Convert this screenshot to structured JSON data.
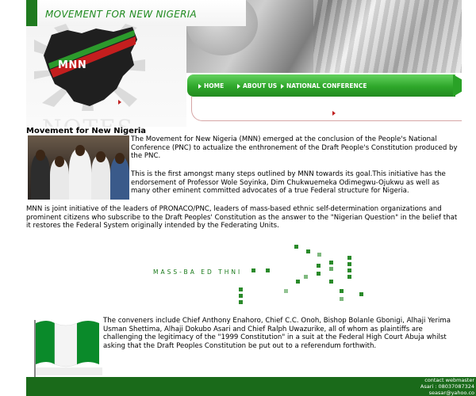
{
  "header": {
    "site_title": "MOVEMENT FOR NEW NIGERIA",
    "logo_text": "MNN",
    "watermark": "NOTES"
  },
  "nav": {
    "items": [
      {
        "label": "HOME"
      },
      {
        "label": "ABOUT US"
      },
      {
        "label": "NATIONAL CONFERENCE"
      }
    ]
  },
  "main": {
    "heading": "Movement for New Nigeria",
    "paragraphs": [
      "The Movement for New Nigeria (MNN) emerged at the conclusion of the People's National Conference (PNC) to actualize the enthronement of the Draft People's Constitution produced by the PNC.",
      "This is the first amongst many steps outlined by MNN towards its goal.This initiative has the endorsement of Professor Wole Soyinka, Dim Chukwuemeka Odimegwu-Ojukwu as well as many other eminent committed advocates of a true Federal structure for Nigeria.",
      "MNN is joint initiative of the leaders of PRONACO/PNC, leaders of mass-based ethnic self-determination organizations and prominent citizens who subscribe to the Draft Peoples' Constitution as the answer to the \"Nigerian Question\" in the belief that it restores the Federal System originally intended by the Federating Units.",
      "The conveners include Chief Anthony Enahoro, Chief C.C. Onoh, Bishop Bolanle Gbonigi, Alhaji Yerima Usman Shettima, Alhaji Dokubo Asari and Chief Ralph Uwazurike, all of whom as plaintiffs are challenging the legitimacy of the \"1999 Constitution\" in a suit at the Federal High Court Abuja whilst asking that the Draft Peoples Constitution be put out to a referendum forthwith."
    ],
    "graphic_text": "MASS-BA  ED  THNI"
  },
  "footer": {
    "contact_lines": [
      "contact webmaster",
      "Asari : 08037087324",
      "seasar@yahoo.co"
    ]
  },
  "colors": {
    "brand_green": "#2ea72a",
    "dark_green": "#1a6a1a",
    "title_green": "#1f8a1f"
  }
}
